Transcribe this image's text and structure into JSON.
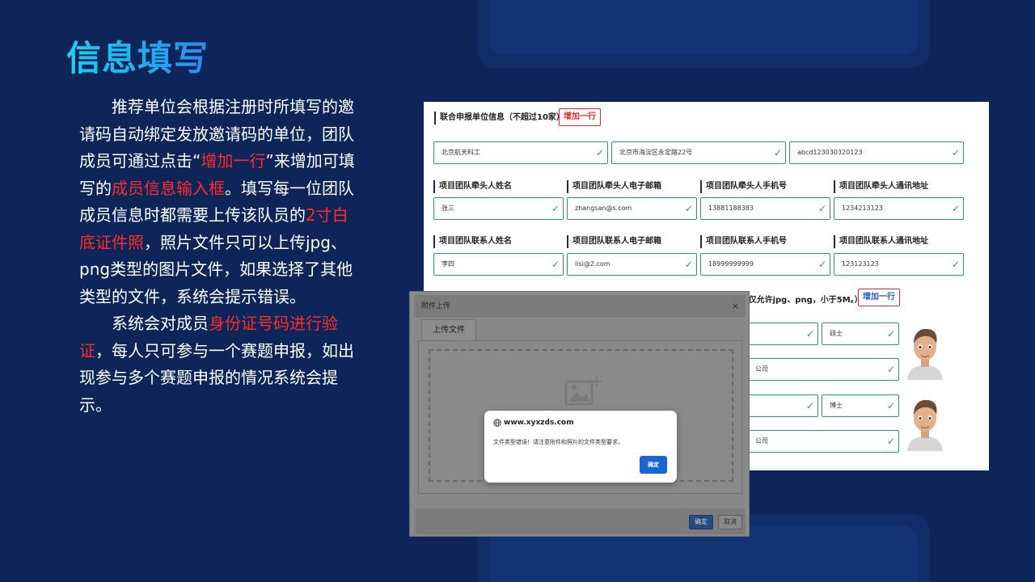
{
  "slide": {
    "title": "信息填写",
    "p1_a": "推荐单位会根据注册时所填写的邀请码自动绑定发放邀请码的单位，团队成员可通过点击“",
    "p1_b": "增加一行",
    "p1_c": "”来增加可填写的",
    "p1_d": "成员信息输入框",
    "p1_e": "。填写每一位团队成员信息时都需要上传该队员的",
    "p1_f": "2寸白底证件照",
    "p1_g": "，照片文件只可以上传jpg、png类型的图片文件，如果选择了其他类型的文件，系统会提示错误。",
    "p2_a": "系统会对成员",
    "p2_b": "身份证号码进行验证",
    "p2_c": "，每人只可参与一个赛题申报，如出现参与多个赛题申报的情况系统会提示。"
  },
  "form": {
    "joint_title": "联合申报单位信息（不超过10家）",
    "add_row": "增加一行",
    "joint_fields": [
      "北京航天科工",
      "北京市海淀区永定路22号",
      "abcd123030320123"
    ],
    "leader_labels": [
      "项目团队牵头人姓名",
      "项目团队牵头人电子邮箱",
      "项目团队牵头人手机号",
      "项目团队牵头人通讯地址"
    ],
    "leader_values": [
      "张三",
      "zhangsan@s.com",
      "13881188383",
      "1234213123"
    ],
    "contact_labels": [
      "项目团队联系人姓名",
      "项目团队联系人电子邮箱",
      "项目团队联系人手机号",
      "项目团队联系人通讯地址"
    ],
    "contact_values": [
      "李四",
      "lisi@2.com",
      "18999999999",
      "123123123"
    ],
    "member_hint": "(仅允许jpg、png，小于5M。）",
    "member_add": "增加一行",
    "member1_degree": "硕士",
    "member1_company": "公司",
    "member2_degree": "博士",
    "member2_company": "公司"
  },
  "dialog": {
    "title": "附件上传",
    "close": "×",
    "tab": "上传文件",
    "ok": "确定",
    "cancel": "取消"
  },
  "alert": {
    "site": "www.xyxzds.com",
    "message": "文件类型错误！请注意附件和照片的文件类型要求。",
    "ok": "确定"
  }
}
